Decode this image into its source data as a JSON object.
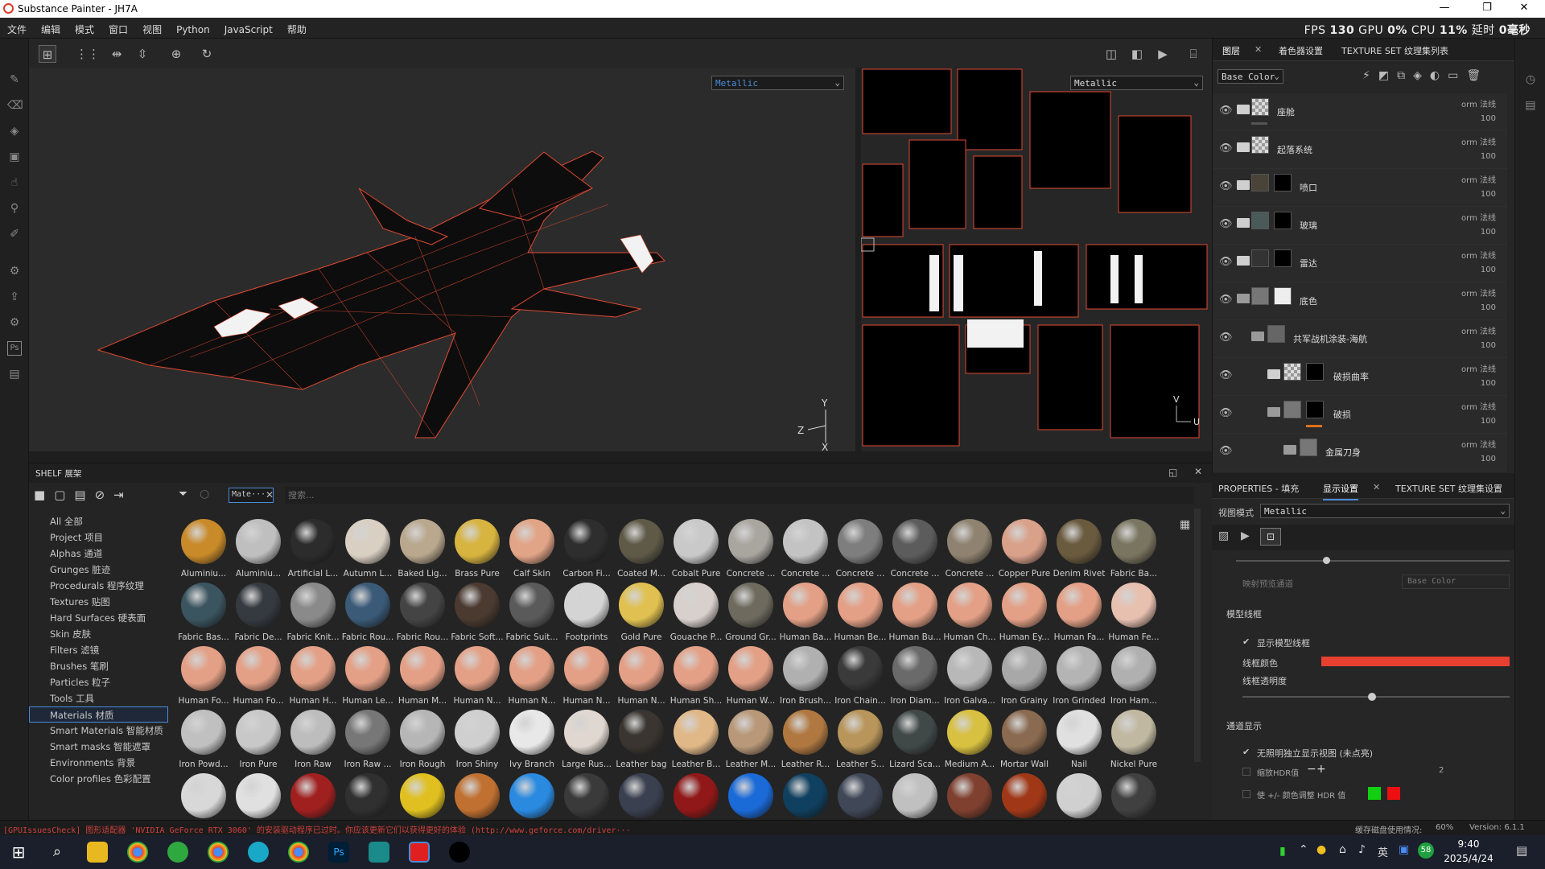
{
  "window": {
    "title": "Substance Painter - JH7A"
  },
  "menu": [
    "文件",
    "编辑",
    "模式",
    "窗口",
    "视图",
    "Python",
    "JavaScript",
    "帮助"
  ],
  "perf": {
    "fps_label": "FPS",
    "fps": "130",
    "gpu_label": "GPU",
    "gpu": "0%",
    "cpu_label": "CPU",
    "cpu": "11%",
    "latency_label": "延时",
    "latency": "0毫秒"
  },
  "viewport": {
    "left_channel": "Metallic",
    "right_channel": "Metallic",
    "axis_z": "Z",
    "axis_y": "Y",
    "axis_x": "X",
    "uv_v": "V",
    "uv_u": "U"
  },
  "layers_panel": {
    "tabs": [
      "图层",
      "着色器设置",
      "TEXTURE SET 纹理集列表"
    ],
    "channel": "Base Color",
    "layers": [
      {
        "name": "座舱",
        "blend": "orm 法线",
        "opacity": "100"
      },
      {
        "name": "起落系统",
        "blend": "orm 法线",
        "opacity": "100"
      },
      {
        "name": "喷口",
        "blend": "orm 法线",
        "opacity": "100"
      },
      {
        "name": "玻璃",
        "blend": "orm 法线",
        "opacity": "100"
      },
      {
        "name": "雷达",
        "blend": "orm 法线",
        "opacity": "100"
      },
      {
        "name": "底色",
        "blend": "orm 法线",
        "opacity": "100"
      },
      {
        "name": "共军战机涂装-海航",
        "blend": "orm 法线",
        "opacity": "100"
      },
      {
        "name": "破损曲率",
        "blend": "orm 法线",
        "opacity": "100"
      },
      {
        "name": "破损",
        "blend": "orm 法线",
        "opacity": "100"
      },
      {
        "name": "金属刀身",
        "blend": "orm 法线",
        "opacity": "100"
      }
    ]
  },
  "shelf": {
    "title": "SHELF 展架",
    "filter_tag": "Mate···",
    "search_placeholder": "搜索...",
    "categories": [
      "All 全部",
      "Project 项目",
      "Alphas 通道",
      "Grunges 脏迹",
      "Procedurals 程序纹理",
      "Textures 贴图",
      "Hard Surfaces 硬表面",
      "Skin 皮肤",
      "Filters 滤镜",
      "Brushes 笔刷",
      "Particles 粒子",
      "Tools 工具",
      "Materials 材质",
      "Smart Materials 智能材质",
      "Smart masks 智能遮罩",
      "Environments 背景",
      "Color profiles 色彩配置"
    ],
    "selected_category": "Materials 材质",
    "materials": [
      {
        "label": "Aluminiu...",
        "color": "#c98a2a"
      },
      {
        "label": "Aluminiu...",
        "color": "#bfbfbf"
      },
      {
        "label": "Artificial L...",
        "color": "#2c2c2c"
      },
      {
        "label": "Autumn L...",
        "color": "#d9cfc2"
      },
      {
        "label": "Baked Lig...",
        "color": "#b9a78e"
      },
      {
        "label": "Brass Pure",
        "color": "#d7b340"
      },
      {
        "label": "Calf Skin",
        "color": "#e1a486"
      },
      {
        "label": "Carbon Fi...",
        "color": "#2e2e2e"
      },
      {
        "label": "Coated M...",
        "color": "#5f5a48"
      },
      {
        "label": "Cobalt Pure",
        "color": "#c9c9c9"
      },
      {
        "label": "Concrete ...",
        "color": "#a9a6a0"
      },
      {
        "label": "Concrete ...",
        "color": "#c3c3c3"
      },
      {
        "label": "Concrete ...",
        "color": "#7e7e7e"
      },
      {
        "label": "Concrete ...",
        "color": "#5c5c5c"
      },
      {
        "label": "Concrete ...",
        "color": "#8f8270"
      },
      {
        "label": "Copper Pure",
        "color": "#d9a08a"
      },
      {
        "label": "Denim Rivet",
        "color": "#6a5a3e"
      },
      {
        "label": "Fabric Ba...",
        "color": "#7a7560"
      },
      {
        "label": "Fabric Bas...",
        "color": "#3b5560"
      },
      {
        "label": "Fabric De...",
        "color": "#353a40"
      },
      {
        "label": "Fabric Knit...",
        "color": "#8a8a8a"
      },
      {
        "label": "Fabric Rou...",
        "color": "#3a5a78"
      },
      {
        "label": "Fabric Rou...",
        "color": "#444444"
      },
      {
        "label": "Fabric Soft...",
        "color": "#4a3a30"
      },
      {
        "label": "Fabric Suit...",
        "color": "#5a5a5a"
      },
      {
        "label": "Footprints",
        "color": "#d4d4d4"
      },
      {
        "label": "Gold Pure",
        "color": "#e0c050"
      },
      {
        "label": "Gouache P...",
        "color": "#d8d0cc"
      },
      {
        "label": "Ground Gr...",
        "color": "#6e6a5e"
      },
      {
        "label": "Human Ba...",
        "color": "#e3a086"
      },
      {
        "label": "Human Be...",
        "color": "#e3a086"
      },
      {
        "label": "Human Bu...",
        "color": "#e3a086"
      },
      {
        "label": "Human Ch...",
        "color": "#e3a086"
      },
      {
        "label": "Human Ey...",
        "color": "#e3a086"
      },
      {
        "label": "Human Fa...",
        "color": "#e3a086"
      },
      {
        "label": "Human Fe...",
        "color": "#e8c0b0"
      },
      {
        "label": "Human Fo...",
        "color": "#e3a086"
      },
      {
        "label": "Human Fo...",
        "color": "#e3a086"
      },
      {
        "label": "Human H...",
        "color": "#e3a086"
      },
      {
        "label": "Human Le...",
        "color": "#e3a086"
      },
      {
        "label": "Human M...",
        "color": "#e3a086"
      },
      {
        "label": "Human N...",
        "color": "#e3a086"
      },
      {
        "label": "Human N...",
        "color": "#e3a086"
      },
      {
        "label": "Human N...",
        "color": "#e3a086"
      },
      {
        "label": "Human N...",
        "color": "#e3a086"
      },
      {
        "label": "Human Sh...",
        "color": "#e3a086"
      },
      {
        "label": "Human W...",
        "color": "#e3a086"
      },
      {
        "label": "Iron Brush...",
        "color": "#b0b0b0"
      },
      {
        "label": "Iron Chain...",
        "color": "#3a3a3a"
      },
      {
        "label": "Iron Diam...",
        "color": "#6a6a6a"
      },
      {
        "label": "Iron Galva...",
        "color": "#b8b8b8"
      },
      {
        "label": "Iron Grainy",
        "color": "#a8a8a8"
      },
      {
        "label": "Iron Grinded",
        "color": "#b4b4b4"
      },
      {
        "label": "Iron Ham...",
        "color": "#b0b0b0"
      },
      {
        "label": "Iron Powd...",
        "color": "#c0c0c0"
      },
      {
        "label": "Iron Pure",
        "color": "#c8c8c8"
      },
      {
        "label": "Iron Raw",
        "color": "#bdbdbd"
      },
      {
        "label": "Iron Raw ...",
        "color": "#777777"
      },
      {
        "label": "Iron Rough",
        "color": "#b6b6b6"
      },
      {
        "label": "Iron Shiny",
        "color": "#cfcfcf"
      },
      {
        "label": "Ivy Branch",
        "color": "#e8e8e8"
      },
      {
        "label": "Large Rus...",
        "color": "#e0d8d0"
      },
      {
        "label": "Leather bag",
        "color": "#3a3530"
      },
      {
        "label": "Leather B...",
        "color": "#e0b888"
      },
      {
        "label": "Leather M...",
        "color": "#b89878"
      },
      {
        "label": "Leather R...",
        "color": "#b07840"
      },
      {
        "label": "Leather S...",
        "color": "#b8955a"
      },
      {
        "label": "Lizard Sca...",
        "color": "#404848"
      },
      {
        "label": "Medium A...",
        "color": "#d8c040"
      },
      {
        "label": "Mortar Wall",
        "color": "#8a6a50"
      },
      {
        "label": "Nail",
        "color": "#e0e0e0"
      },
      {
        "label": "Nickel Pure",
        "color": "#c0b8a0"
      },
      {
        "label": "",
        "color": "#d8d8d8"
      },
      {
        "label": "",
        "color": "#e0e0e0"
      },
      {
        "label": "",
        "color": "#a02020"
      },
      {
        "label": "",
        "color": "#303030"
      },
      {
        "label": "",
        "color": "#e0c020"
      },
      {
        "label": "",
        "color": "#c07030"
      },
      {
        "label": "",
        "color": "#2a8ae0"
      },
      {
        "label": "",
        "color": "#3a3a3a"
      },
      {
        "label": "",
        "color": "#3a4050"
      },
      {
        "label": "",
        "color": "#901818"
      },
      {
        "label": "",
        "color": "#1a6ad8"
      },
      {
        "label": "",
        "color": "#104060"
      },
      {
        "label": "",
        "color": "#404858"
      },
      {
        "label": "",
        "color": "#c0c0c0"
      },
      {
        "label": "",
        "color": "#804030"
      },
      {
        "label": "",
        "color": "#a03818"
      },
      {
        "label": "",
        "color": "#d0d0d0"
      },
      {
        "label": "",
        "color": "#404040"
      }
    ]
  },
  "props": {
    "tabs": [
      "PROPERTIES - 填充",
      "显示设置",
      "TEXTURE SET 纹理集设置"
    ],
    "view_mode_label": "视图模式",
    "view_mode_value": "Metallic",
    "ghost_channel_label": "映射预览通道",
    "ghost_channel_value": "Base Color",
    "wireframe_section": "模型线框",
    "show_wireframe": "显示模型线框",
    "wire_color_label": "线框颜色",
    "wire_opacity_label": "线框透明度",
    "channel_section": "通道显示",
    "option1": "无照明独立显示视图 (未点亮)",
    "option2_label": "缩放HDR值",
    "option2_value": "2",
    "option3": "使 +/- 颜色调整 HDR 值",
    "wire_color": "#e84030"
  },
  "status": {
    "message": "[GPUIssuesCheck] 图形适配器 'NVIDIA GeForce RTX 3060' 的安装驱动程序已过时。你应该更新它们以获得更好的体验 (http://www.geforce.com/driver···",
    "disk_label": "缓存磁盘使用情况:",
    "disk_value": "60%",
    "version": "Version: 6.1.1"
  },
  "taskbar": {
    "time": "9:40",
    "date": "2025/4/24",
    "ime": "英",
    "badge": "58"
  }
}
